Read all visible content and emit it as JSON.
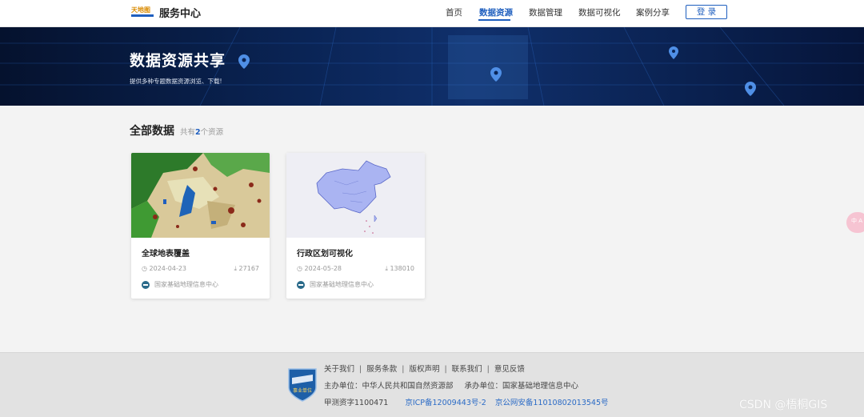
{
  "header": {
    "brand": "服务中心",
    "nav": [
      "首页",
      "数据资源",
      "数据管理",
      "数据可视化",
      "案例分享"
    ],
    "login": "登 录"
  },
  "banner": {
    "title": "数据资源共享",
    "subtitle": "提供多种专题数据资源浏览、下载!"
  },
  "section": {
    "title": "全部数据",
    "count_prefix": "共有",
    "count": "2",
    "count_suffix": "个资源"
  },
  "cards": [
    {
      "name": "全球地表覆盖",
      "date": "2024-04-23",
      "downloads": "27167",
      "org": "国家基础地理信息中心"
    },
    {
      "name": "行政区划可视化",
      "date": "2024-05-28",
      "downloads": "138010",
      "org": "国家基础地理信息中心"
    }
  ],
  "side_float": "中 A",
  "footer": {
    "links": [
      "关于我们",
      "服务条款",
      "版权声明",
      "联系我们",
      "意见反馈"
    ],
    "host": "主办单位：中华人民共和国自然资源部",
    "operator": "承办单位：国家基础地理信息中心",
    "license": "甲测资字1100471",
    "icp": "京ICP备12009443号-2",
    "police": "京公网安备11010802013545号",
    "badge_text": "事业单位"
  },
  "watermark": "CSDN @梧桐GIS",
  "colors": {
    "accent": "#1f5fbf",
    "banner_dark": "#06153a"
  }
}
